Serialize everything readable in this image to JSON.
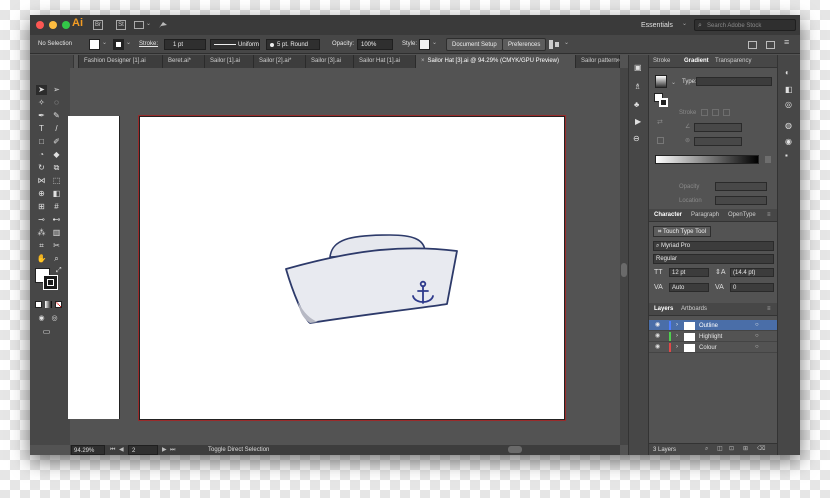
{
  "app": {
    "logo": "Ai",
    "bridge": "Br",
    "stock": "St"
  },
  "workspace": {
    "label": "Essentials",
    "search_placeholder": "Search Adobe Stock"
  },
  "control_bar": {
    "selection": "No Selection",
    "stroke_label": "Stroke:",
    "stroke_weight": "1 pt",
    "uniform": "Uniform",
    "brush": "5 pt. Round",
    "opacity_label": "Opacity:",
    "opacity_value": "100%",
    "style_label": "Style:",
    "doc_setup": "Document Setup",
    "preferences": "Preferences"
  },
  "tabs": [
    {
      "label": "Fashion Designer [1].ai"
    },
    {
      "label": "Beret.ai*"
    },
    {
      "label": "Sailor [1].ai"
    },
    {
      "label": "Sailor [2].ai*"
    },
    {
      "label": "Sailor [3].ai"
    },
    {
      "label": "Sailor Hat [1].ai"
    },
    {
      "label": "Sailor Hat [3].ai @ 94.29% (CMYK/GPU Preview)"
    },
    {
      "label": "Sailor pattern"
    }
  ],
  "status": {
    "zoom": "94.29%",
    "artboard": "2",
    "tool_hint": "Toggle Direct Selection"
  },
  "gradient_panel": {
    "tabs": [
      "Stroke",
      "Gradient",
      "Transparency"
    ],
    "type_label": "Type:",
    "stroke_label": "Stroke",
    "opacity_label": "Opacity",
    "location_label": "Location"
  },
  "character_panel": {
    "tabs": [
      "Character",
      "Paragraph",
      "OpenType"
    ],
    "touch_type": "Touch Type Tool",
    "font": "Myriad Pro",
    "style": "Regular",
    "size": "12 pt",
    "leading": "(14.4 pt)",
    "kerning": "Auto",
    "tracking": "0"
  },
  "layers_panel": {
    "tabs": [
      "Layers",
      "Artboards"
    ],
    "layers": [
      {
        "name": "Outline",
        "color": "#4f7fff"
      },
      {
        "name": "Highlight",
        "color": "#4fd04f"
      },
      {
        "name": "Colour",
        "color": "#e04848"
      }
    ],
    "count": "3 Layers"
  },
  "colors": {
    "accent": "#2f66b3",
    "hat_fill": "#e6e8ee",
    "hat_stroke": "#2d3a6a",
    "anchor": "#2e3a8c",
    "artboard_border": "#a02a2a"
  }
}
